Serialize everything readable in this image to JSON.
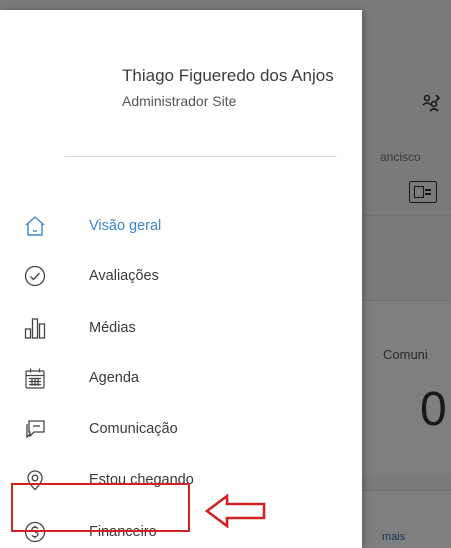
{
  "user": {
    "name": "Thiago Figueredo dos Anjos",
    "role": "Administrador Site"
  },
  "menu": {
    "items": [
      {
        "label": "Visão geral",
        "icon": "home-icon",
        "active": true
      },
      {
        "label": "Avaliações",
        "icon": "check-circle-icon",
        "active": false
      },
      {
        "label": "Médias",
        "icon": "bar-chart-icon",
        "active": false
      },
      {
        "label": "Agenda",
        "icon": "calendar-icon",
        "active": false
      },
      {
        "label": "Comunicação",
        "icon": "chat-icon",
        "active": false
      },
      {
        "label": "Estou chegando",
        "icon": "location-pin-icon",
        "active": false
      },
      {
        "label": "Financeiro",
        "icon": "dollar-circle-icon",
        "active": false
      }
    ]
  },
  "background": {
    "student_name_partial": "ancisco",
    "panel_title_partial": "Comuni",
    "panel_value": "0",
    "more_link_partial": "mais"
  },
  "colors": {
    "active": "#3d87c9",
    "highlight": "#d02323"
  }
}
